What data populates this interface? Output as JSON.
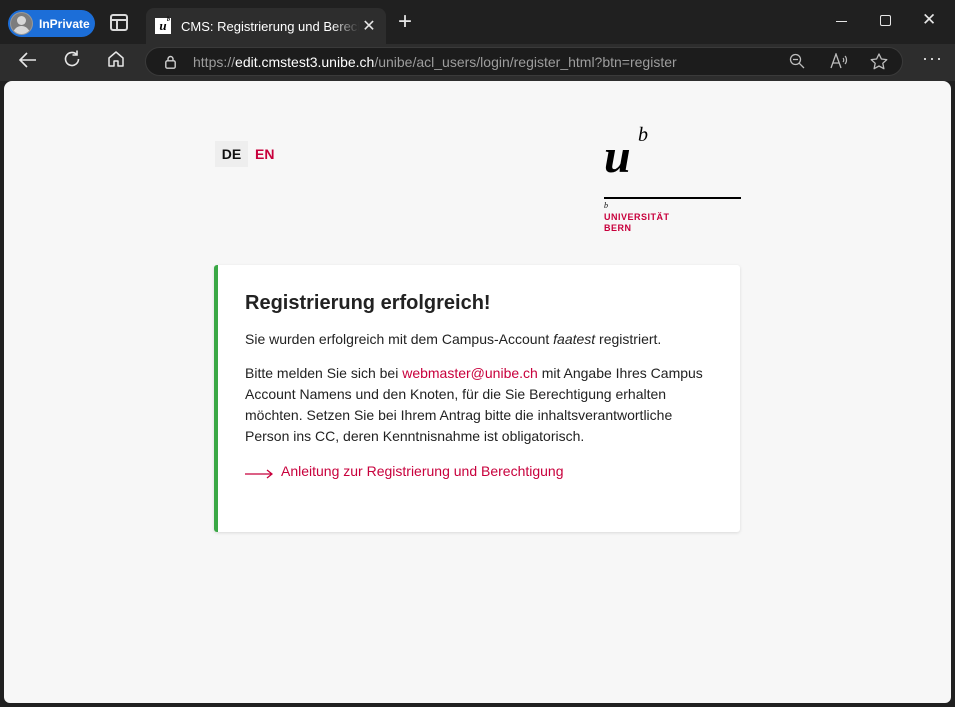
{
  "browser": {
    "inprivate_label": "InPrivate",
    "tab_title": "CMS: Registrierung und Berechtigung",
    "url_scheme": "https://",
    "url_host": "edit.cmstest3.unibe.ch",
    "url_path": "/unibe/acl_users/login/register_html?btn=register",
    "icons": [
      "avatar-icon",
      "tab-actions-icon",
      "favicon-icon",
      "close-icon",
      "plus-icon",
      "minimize-icon",
      "maximize-icon",
      "close-window-icon",
      "back-icon",
      "refresh-icon",
      "home-icon",
      "lock-icon",
      "zoom-icon",
      "read-aloud-icon",
      "favorite-icon",
      "more-icon"
    ]
  },
  "page": {
    "lang": {
      "de": "DE",
      "en": "EN"
    },
    "logo": {
      "u": "u",
      "b": "b",
      "small_b": "b",
      "line1": "UNIVERSITÄT",
      "line2": "BERN"
    },
    "card": {
      "title": "Registrierung erfolgreich!",
      "p1_before": "Sie wurden erfolgreich mit dem Campus-Account ",
      "p1_account": "faatest",
      "p1_after": " registriert.",
      "p2_before": "Bitte melden Sie sich bei ",
      "p2_email": "webmaster@unibe.ch",
      "p2_after": " mit Angabe Ihres Campus Account Namens und den Knoten, für die Sie Berechtigung erhalten möchten. Setzen Sie bei Ihrem Antrag bitte die inhaltsverantwortliche Person ins CC, deren Kenntnisnahme ist obligatorisch.",
      "guide_link": "Anleitung zur Registrierung und Berechtigung"
    }
  },
  "colors": {
    "accent": "#c8003c",
    "success_border": "#3aa845",
    "inprivate": "#1c6ed8"
  }
}
